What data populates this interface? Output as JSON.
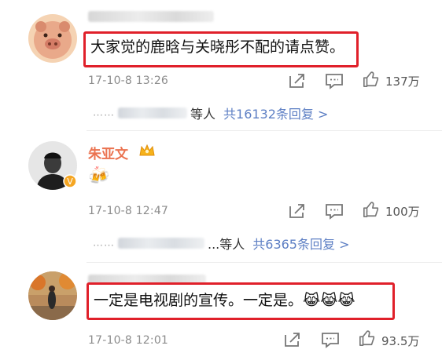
{
  "comments": [
    {
      "user": "",
      "text": "大家觉的鹿晗与关晓彤不配的请点赞。",
      "time": "17-10-8 13:26",
      "likes": "137万",
      "replies": {
        "dots": "……",
        "suffix": "等人",
        "link": "共16132条回复 >"
      }
    },
    {
      "user": "朱亚文",
      "text": "🍻",
      "time": "17-10-8 12:47",
      "likes": "100万",
      "replies": {
        "dots": "……",
        "suffix": "...等人",
        "link": "共6365条回复 >"
      }
    },
    {
      "user": "",
      "text": "一定是电视剧的宣传。一定是。😹😹😹",
      "time": "17-10-8 12:01",
      "likes": "93.5万"
    }
  ],
  "colors": {
    "highlight_border": "#e0202a",
    "username": "#eb7350",
    "link": "#5d7fc4",
    "meta": "#8c8c8c"
  },
  "icons": [
    "pig-avatar",
    "profile-avatar",
    "autumn-avatar",
    "crown-icon",
    "verified-icon",
    "share-icon",
    "comment-icon",
    "like-icon"
  ]
}
